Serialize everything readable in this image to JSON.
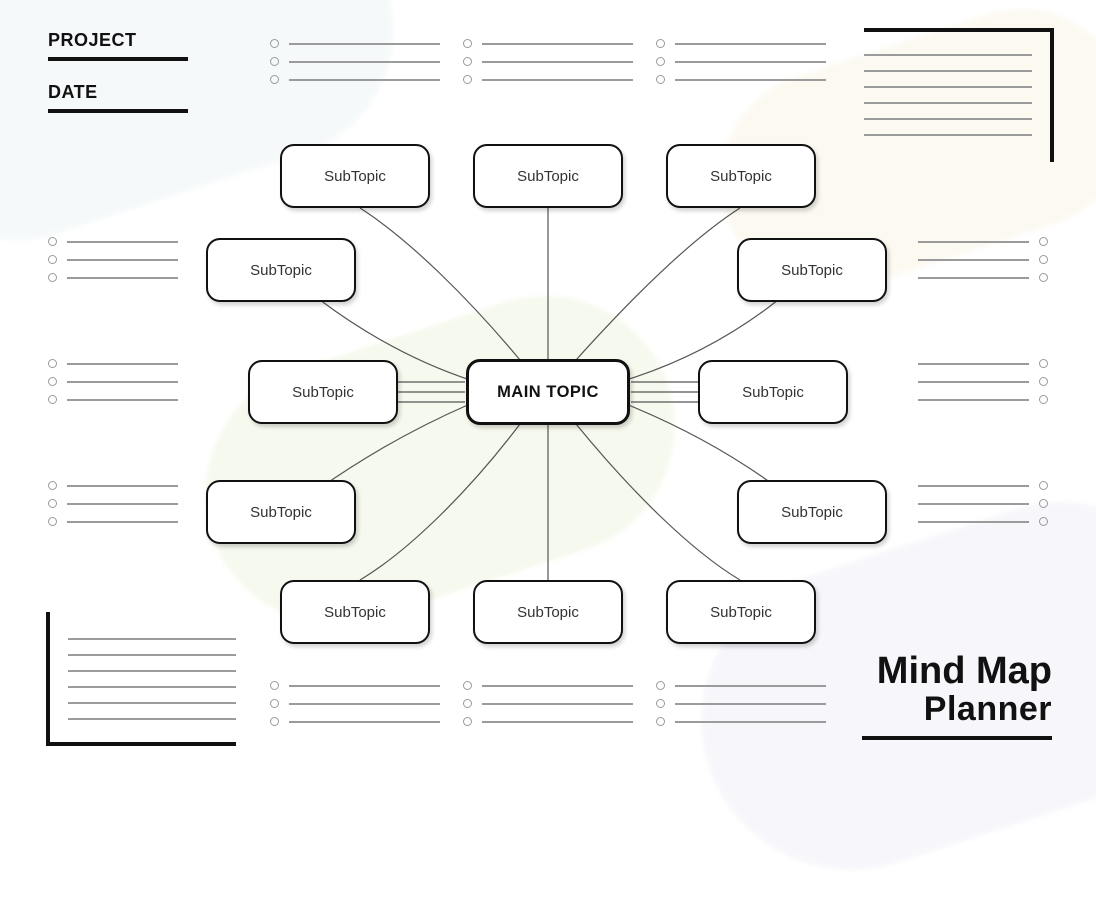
{
  "header": {
    "project_label": "PROJECT",
    "date_label": "DATE"
  },
  "title": {
    "line1": "Mind Map",
    "line2": "Planner"
  },
  "main_topic": "MAIN TOPIC",
  "subtopics": {
    "top1": "SubTopic",
    "top2": "SubTopic",
    "top3": "SubTopic",
    "left_upper": "SubTopic",
    "left_mid": "SubTopic",
    "left_lower": "SubTopic",
    "right_upper": "SubTopic",
    "right_mid": "SubTopic",
    "right_lower": "SubTopic",
    "bottom1": "SubTopic",
    "bottom2": "SubTopic",
    "bottom3": "SubTopic"
  }
}
